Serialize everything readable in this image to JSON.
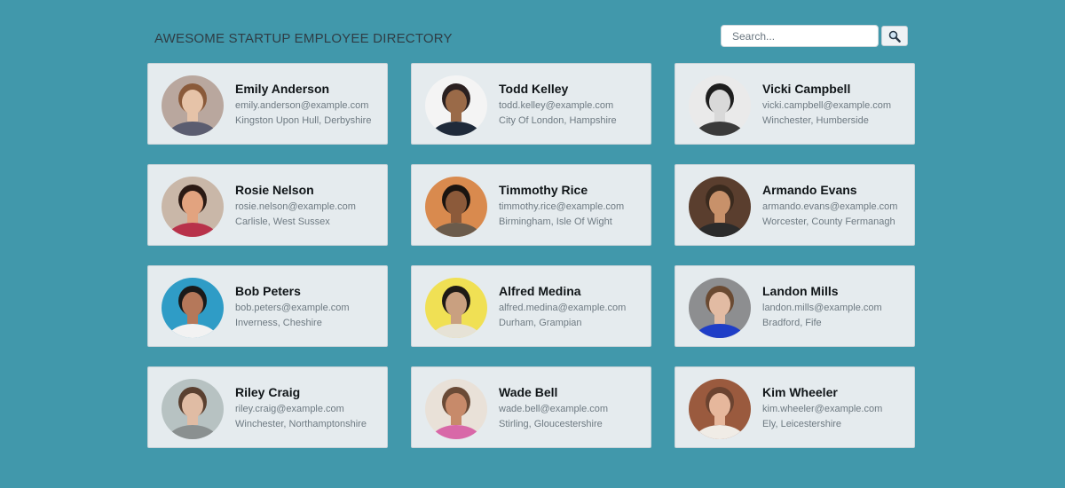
{
  "header": {
    "title": "Awesome Startup Employee Directory",
    "search_placeholder": "Search...",
    "search_icon": "search-icon"
  },
  "employees": [
    {
      "name": "Emily Anderson",
      "email": "emily.anderson@example.com",
      "location": "Kingston Upon Hull, Derbyshire",
      "bg": "#b9a79e",
      "skin": "#e6c3a8",
      "hair": "#8a5a3a",
      "shirt": "#5b5d70"
    },
    {
      "name": "Todd Kelley",
      "email": "todd.kelley@example.com",
      "location": "City Of London, Hampshire",
      "bg": "#f4f4f4",
      "skin": "#9a6a48",
      "hair": "#2a2020",
      "shirt": "#1f2a3a"
    },
    {
      "name": "Vicki Campbell",
      "email": "vicki.campbell@example.com",
      "location": "Winchester, Humberside",
      "bg": "#eaeaea",
      "skin": "#d9d9d9",
      "hair": "#1e1e1e",
      "shirt": "#3a3a3a"
    },
    {
      "name": "Rosie Nelson",
      "email": "rosie.nelson@example.com",
      "location": "Carlisle, West Sussex",
      "bg": "#c9b7a8",
      "skin": "#e2a37f",
      "hair": "#2b1a14",
      "shirt": "#b8324a"
    },
    {
      "name": "Timmothy Rice",
      "email": "timmothy.rice@example.com",
      "location": "Birmingham, Isle Of Wight",
      "bg": "#d98a4e",
      "skin": "#8c5a3a",
      "hair": "#1a1410",
      "shirt": "#6b5b4b"
    },
    {
      "name": "Armando Evans",
      "email": "armando.evans@example.com",
      "location": "Worcester, County Fermanagh",
      "bg": "#5a3e2e",
      "skin": "#c8916a",
      "hair": "#3a2a1e",
      "shirt": "#2b2b2b"
    },
    {
      "name": "Bob Peters",
      "email": "bob.peters@example.com",
      "location": "Inverness, Cheshire",
      "bg": "#2f9cc6",
      "skin": "#b5785a",
      "hair": "#1a1a1a",
      "shirt": "#f2f2f2"
    },
    {
      "name": "Alfred Medina",
      "email": "alfred.medina@example.com",
      "location": "Durham, Grampian",
      "bg": "#f0e054",
      "skin": "#c9a080",
      "hair": "#1e1a16",
      "shirt": "#e6e2d6"
    },
    {
      "name": "Landon Mills",
      "email": "landon.mills@example.com",
      "location": "Bradford, Fife",
      "bg": "#8d8e90",
      "skin": "#e2bba3",
      "hair": "#6a4a32",
      "shirt": "#1f3ec7"
    },
    {
      "name": "Riley Craig",
      "email": "riley.craig@example.com",
      "location": "Winchester, Northamptonshire",
      "bg": "#b7c2c2",
      "skin": "#e0bca4",
      "hair": "#5a4030",
      "shirt": "#8a9090"
    },
    {
      "name": "Wade Bell",
      "email": "wade.bell@example.com",
      "location": "Stirling, Gloucestershire",
      "bg": "#e9e1d8",
      "skin": "#c78a6a",
      "hair": "#6a4a36",
      "shirt": "#d868a8"
    },
    {
      "name": "Kim Wheeler",
      "email": "kim.wheeler@example.com",
      "location": "Ely, Leicestershire",
      "bg": "#9a5a3e",
      "skin": "#e6b79c",
      "hair": "#6b4330",
      "shirt": "#f0ece6"
    }
  ]
}
